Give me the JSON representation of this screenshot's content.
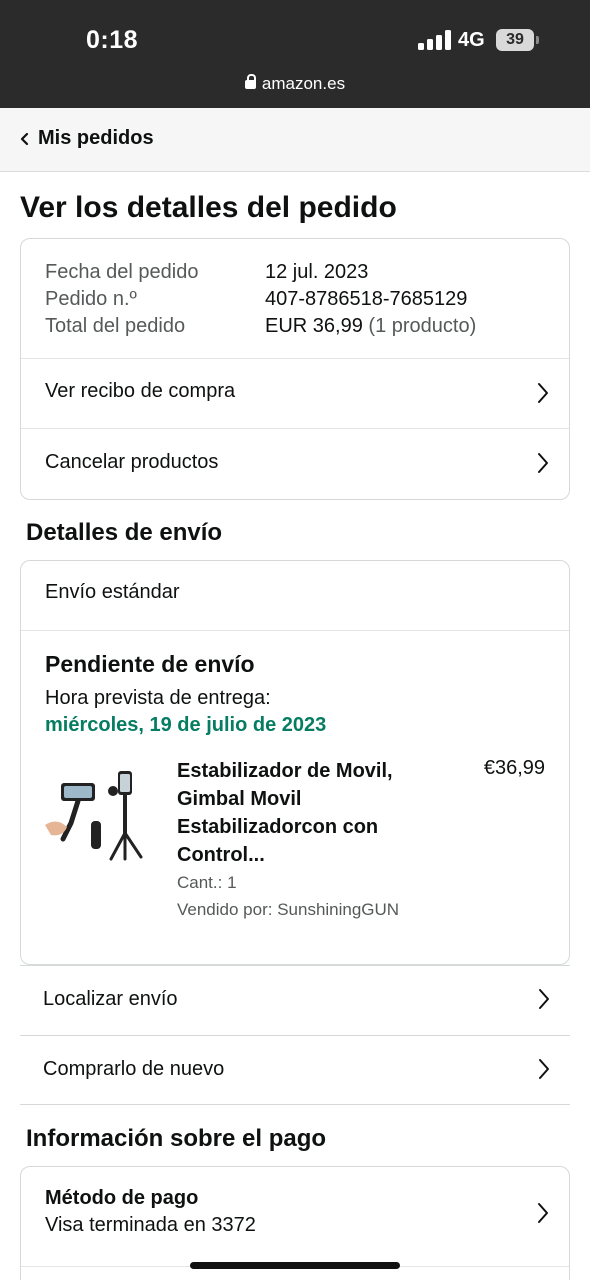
{
  "status_bar": {
    "time": "0:18",
    "network": "4G",
    "battery": "39",
    "url": "amazon.es"
  },
  "nav": {
    "back_label": "Mis pedidos"
  },
  "page_title": "Ver los detalles del pedido",
  "order_summary": {
    "date_label": "Fecha del pedido",
    "date_value": "12 jul. 2023",
    "number_label": "Pedido n.º",
    "number_value": "407-8786518-7685129",
    "total_label": "Total del pedido",
    "total_value": "EUR 36,99",
    "total_count": "(1 producto)"
  },
  "order_actions": [
    "Ver recibo de compra",
    "Cancelar productos"
  ],
  "shipping": {
    "section_title": "Detalles de envío",
    "method": "Envío estándar",
    "status": "Pendiente de envío",
    "delivery_label": "Hora prevista de entrega:",
    "delivery_date": "miércoles, 19 de julio de 2023",
    "product": {
      "title": "Estabilizador de Movil, Gimbal Movil Estabilizadorcon con Control...",
      "price": "€36,99",
      "qty": "Cant.: 1",
      "seller": "Vendido por: SunshiningGUN"
    },
    "actions": [
      "Localizar envío",
      "Comprarlo de nuevo"
    ]
  },
  "payment": {
    "section_title": "Información sobre el pago",
    "method_label": "Método de pago",
    "method_value": "Visa terminada en 3372"
  },
  "colors": {
    "status_bar": "#2b2b2b",
    "delivery_green": "#067d62",
    "border": "#d5d9d9"
  }
}
